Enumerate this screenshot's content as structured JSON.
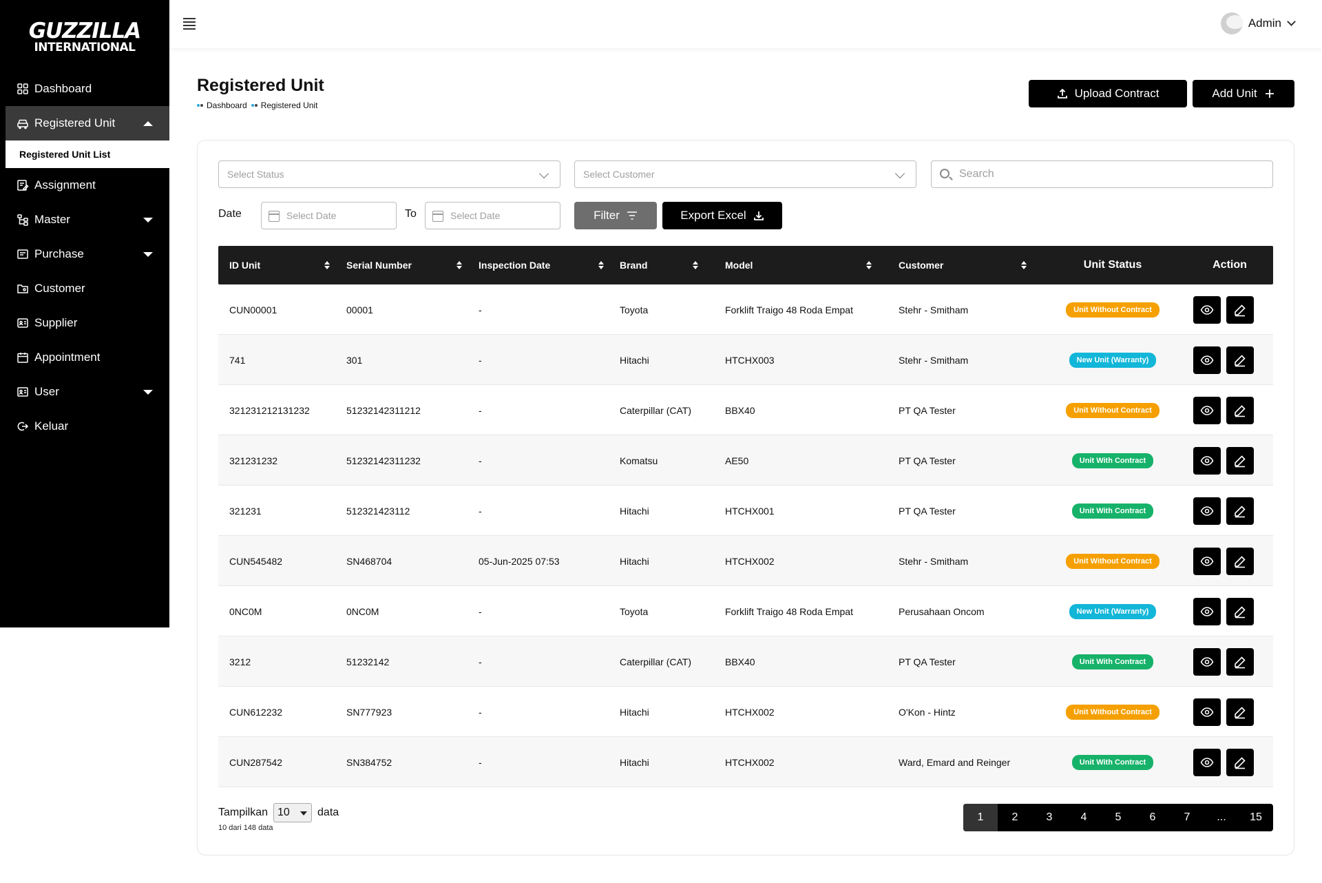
{
  "logo": {
    "line1": "GUZZILLA",
    "line2": "INTERNATIONAL"
  },
  "sidebar": {
    "items": [
      {
        "label": "Dashboard",
        "icon": "grid-icon"
      },
      {
        "label": "Registered Unit",
        "icon": "car-icon",
        "expanded": true
      },
      {
        "label": "Assignment",
        "icon": "clipboard-edit-icon"
      },
      {
        "label": "Master",
        "icon": "hierarchy-icon",
        "has_children": true
      },
      {
        "label": "Purchase",
        "icon": "receipt-icon",
        "has_children": true
      },
      {
        "label": "Customer",
        "icon": "folder-user-icon"
      },
      {
        "label": "Supplier",
        "icon": "id-card-icon"
      },
      {
        "label": "Appointment",
        "icon": "calendar-icon"
      },
      {
        "label": "User",
        "icon": "user-card-icon",
        "has_children": true
      },
      {
        "label": "Keluar",
        "icon": "logout-icon"
      }
    ],
    "subitem": "Registered Unit List"
  },
  "topbar": {
    "user": "Admin"
  },
  "page": {
    "title": "Registered Unit",
    "breadcrumb": [
      "Dashboard",
      "Registered Unit"
    ],
    "upload_label": "Upload Contract",
    "add_label": "Add Unit"
  },
  "filters": {
    "status_placeholder": "Select Status",
    "customer_placeholder": "Select Customer",
    "search_placeholder": "Search",
    "date_label": "Date",
    "to_label": "To",
    "date_from_placeholder": "Select Date",
    "date_to_placeholder": "Select Date",
    "filter_label": "Filter",
    "export_label": "Export Excel"
  },
  "table": {
    "headers": [
      "ID Unit",
      "Serial Number",
      "Inspection Date",
      "Brand",
      "Model",
      "Customer",
      "Unit Status",
      "Action"
    ],
    "rows": [
      {
        "id": "CUN00001",
        "serial": "00001",
        "date": "-",
        "brand": "Toyota",
        "model": "Forklift Traigo 48 Roda Empat",
        "customer": "Stehr - Smitham",
        "status": "Unit Without Contract",
        "status_type": "without"
      },
      {
        "id": "741",
        "serial": "301",
        "date": "-",
        "brand": "Hitachi",
        "model": "HTCHX003",
        "customer": "Stehr - Smitham",
        "status": "New Unit (Warranty)",
        "status_type": "new"
      },
      {
        "id": "321231212131232",
        "serial": "51232142311212",
        "date": "-",
        "brand": "Caterpillar (CAT)",
        "model": "BBX40",
        "customer": "PT QA Tester",
        "status": "Unit Without Contract",
        "status_type": "without"
      },
      {
        "id": "321231232",
        "serial": "51232142311232",
        "date": "-",
        "brand": "Komatsu",
        "model": "AE50",
        "customer": "PT QA Tester",
        "status": "Unit With Contract",
        "status_type": "with"
      },
      {
        "id": "321231",
        "serial": "512321423112",
        "date": "-",
        "brand": "Hitachi",
        "model": "HTCHX001",
        "customer": "PT QA Tester",
        "status": "Unit With Contract",
        "status_type": "with"
      },
      {
        "id": "CUN545482",
        "serial": "SN468704",
        "date": "05-Jun-2025 07:53",
        "brand": "Hitachi",
        "model": "HTCHX002",
        "customer": "Stehr - Smitham",
        "status": "Unit Without Contract",
        "status_type": "without"
      },
      {
        "id": "0NC0M",
        "serial": "0NC0M",
        "date": "-",
        "brand": "Toyota",
        "model": "Forklift Traigo 48 Roda Empat",
        "customer": "Perusahaan Oncom",
        "status": "New Unit (Warranty)",
        "status_type": "new"
      },
      {
        "id": "3212",
        "serial": "51232142",
        "date": "-",
        "brand": "Caterpillar (CAT)",
        "model": "BBX40",
        "customer": "PT QA Tester",
        "status": "Unit With Contract",
        "status_type": "with"
      },
      {
        "id": "CUN612232",
        "serial": "SN777923",
        "date": "-",
        "brand": "Hitachi",
        "model": "HTCHX002",
        "customer": "O'Kon - Hintz",
        "status": "Unit Without Contract",
        "status_type": "without"
      },
      {
        "id": "CUN287542",
        "serial": "SN384752",
        "date": "-",
        "brand": "Hitachi",
        "model": "HTCHX002",
        "customer": "Ward, Emard and Reinger",
        "status": "Unit With Contract",
        "status_type": "with"
      }
    ]
  },
  "pagination": {
    "show_label": "Tampilkan",
    "page_size": "10",
    "data_label": "data",
    "info": "10 dari 148 data",
    "pages": [
      "1",
      "2",
      "3",
      "4",
      "5",
      "6",
      "7",
      "...",
      "15"
    ],
    "current": "1"
  },
  "colors": {
    "without": "#f5a000",
    "new": "#12b6d8",
    "with": "#17b26a"
  }
}
